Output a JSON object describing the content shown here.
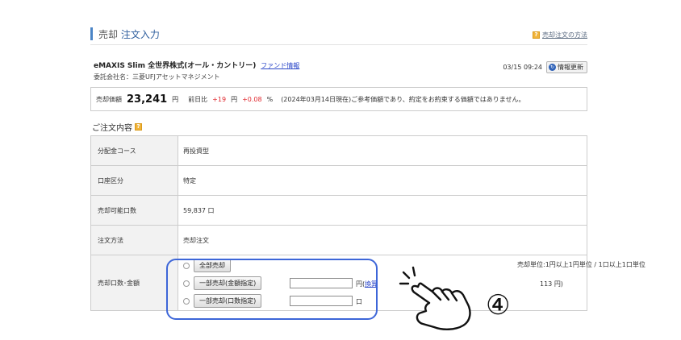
{
  "header": {
    "title_part1": "売却",
    "title_part2": "注文入力",
    "help_link": "売却注文の方法"
  },
  "fund": {
    "name": "eMAXIS Slim 全世界株式(オール・カントリー)",
    "info_link": "ファンド情報",
    "company": "委託会社名：三菱UFJアセットマネジメント",
    "datetime": "03/15 09:24",
    "refresh_label": "情報更新"
  },
  "price": {
    "label": "売却価額",
    "value": "23,241",
    "unit": "円",
    "change_label": "前日比",
    "change_value": "+19",
    "change_unit": "円",
    "change_pct": "+0.08",
    "pct_unit": "%",
    "note": "(2024年03月14日現在)ご参考価額であり、約定をお約束する価額ではありません。"
  },
  "order": {
    "section_title": "ご注文内容",
    "rows": [
      {
        "label": "分配金コース",
        "value": "再投資型"
      },
      {
        "label": "口座区分",
        "value": "特定"
      },
      {
        "label": "売却可能口数",
        "value": "59,837 口"
      },
      {
        "label": "注文方法",
        "value": "売却注文"
      }
    ],
    "qty_label": "売却口数･金額",
    "options": {
      "all": "全部売却",
      "partial_amount": "一部売却(金額指定)",
      "partial_units": "一部売却(口数指定)"
    },
    "yen_unit": "円",
    "paren_open": "(",
    "sim_link": "換算",
    "unit_kuchi": "口",
    "note1": "売却単位:1円以上1円単位 / 1口以上1口単位",
    "note2": "113 円)"
  },
  "annotation": {
    "step": "④"
  },
  "colors": {
    "accent_blue": "#4a84c6",
    "highlight": "#3d66d8",
    "up_red": "#e0282e",
    "help_icon": "#f1b43a"
  }
}
